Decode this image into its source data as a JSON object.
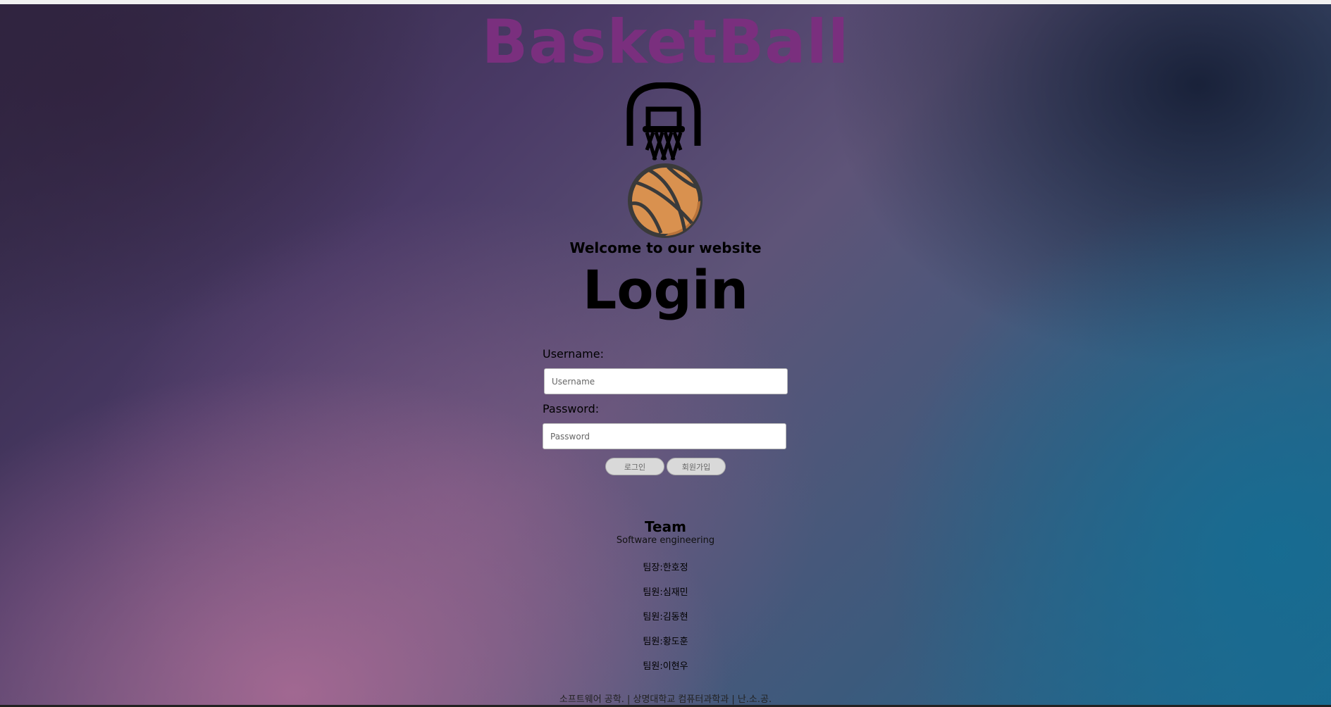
{
  "header": {
    "site_title": "BasketBall"
  },
  "icons": {
    "hoop": "basketball-hoop-icon",
    "ball": "basketball-icon"
  },
  "colors": {
    "title": "#7a2f7e",
    "ball": "#d9914f"
  },
  "intro": {
    "welcome": "Welcome to our website",
    "heading": "Login"
  },
  "form": {
    "username_label": "Username:",
    "username_placeholder": "Username",
    "username_value": "",
    "password_label": "Password:",
    "password_placeholder": "Password",
    "password_value": "",
    "login_button": "로그인",
    "signup_button": "회원가입"
  },
  "team": {
    "title": "Team",
    "subtitle": "Software engineering",
    "members": [
      "팀장:한호정",
      "팀원:심재민",
      "팀원:김동현",
      "팀원:황도훈",
      "팀원:이현우"
    ]
  },
  "footer": {
    "text": "소프트웨어 공학. | 상명대학교 컴퓨터과학과 | 난.소.공."
  }
}
